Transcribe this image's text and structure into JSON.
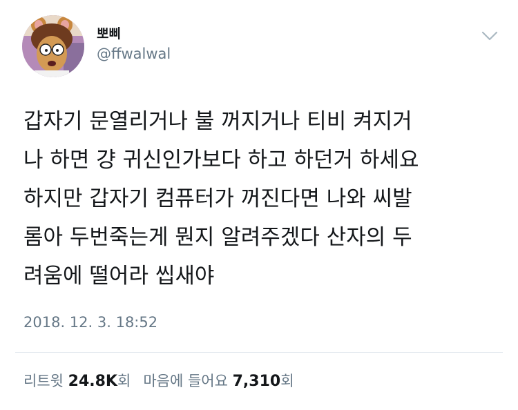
{
  "author": {
    "name": "뽀삐",
    "handle": "@ffwalwal"
  },
  "tweet": {
    "text": "갑자기 문열리거나 불 꺼지거나 티비 켜지거\n나 하면 걍 귀신인가보다 하고 하던거 하세요\n하지만 갑자기 컴퓨터가 꺼진다면 나와 씨발\n롬아 두번죽는게 뭔지 알려주겠다 산자의 두\n려움에 떨어라 씹새야",
    "timestamp": "2018. 12. 3. 18:52"
  },
  "stats": {
    "retweets_label": "리트윗",
    "retweets_count": "24.8K",
    "retweets_unit": "회",
    "likes_label": "마음에 들어요",
    "likes_count": "7,310",
    "likes_unit": "회"
  },
  "icons": {
    "menu": "chevron-down-icon",
    "avatar": "cartoon-character-avatar"
  },
  "colors": {
    "text": "#14171a",
    "secondary": "#657786",
    "divider": "#e1e8ed"
  }
}
